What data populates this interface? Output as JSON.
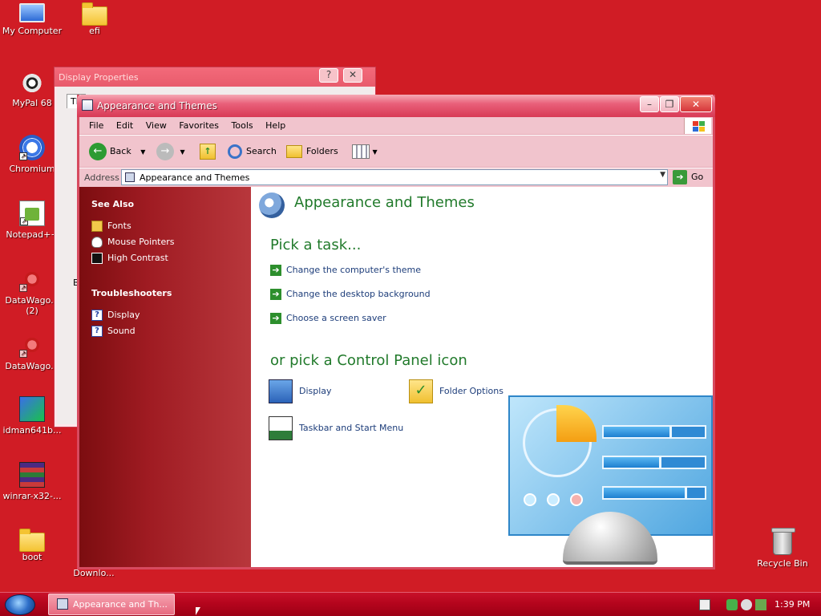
{
  "desktop": {
    "icons": [
      {
        "label": "My Computer",
        "icon": "computer-icon"
      },
      {
        "label": "efi",
        "icon": "folder-icon"
      },
      {
        "label": "MyPal 68",
        "icon": "mypal-icon"
      },
      {
        "label": "Chromium",
        "icon": "chromium-icon"
      },
      {
        "label": "Notepad++",
        "icon": "notepadpp-icon"
      },
      {
        "label": "DataWago...(2)",
        "icon": "datawagon-icon"
      },
      {
        "label": "DataWago...",
        "icon": "datawagon-icon"
      },
      {
        "label": "idman641b...",
        "icon": "idm-icon"
      },
      {
        "label": "winrar-x32-...",
        "icon": "winrar-icon"
      },
      {
        "label": "boot",
        "icon": "folder-icon"
      },
      {
        "label": "Downlo...",
        "icon": "download-icon"
      },
      {
        "label": "Recycle Bin",
        "icon": "recycle-bin-icon"
      }
    ]
  },
  "background_window": {
    "title": "Display Properties",
    "tab_fragment": "Th",
    "side_fragment": "B",
    "help_button": "?",
    "close_button": "✕"
  },
  "window": {
    "title": "Appearance and Themes",
    "menu": [
      "File",
      "Edit",
      "View",
      "Favorites",
      "Tools",
      "Help"
    ],
    "toolbar": {
      "back": "Back",
      "search": "Search",
      "folders": "Folders"
    },
    "address": {
      "label": "Address",
      "value": "Appearance and Themes",
      "go": "Go"
    },
    "sidebar": {
      "see_also_title": "See Also",
      "see_also": [
        "Fonts",
        "Mouse Pointers",
        "High Contrast"
      ],
      "troubleshooters_title": "Troubleshooters",
      "troubleshooters": [
        "Display",
        "Sound"
      ]
    },
    "content": {
      "header": "Appearance and Themes",
      "pick_task": "Pick a task...",
      "tasks": [
        "Change the computer's theme",
        "Change the desktop background",
        "Choose a screen saver"
      ],
      "pick_icon": "or pick a Control Panel icon",
      "icons": [
        "Display",
        "Folder Options",
        "Taskbar and Start Menu"
      ]
    }
  },
  "taskbar": {
    "active_task": "Appearance and Th...",
    "clock": "1:39 PM"
  },
  "colors": {
    "desktop": "#d01c25",
    "sidebar_dark": "#7c0d10",
    "heading_green": "#217a2b",
    "link_blue": "#1d3d7a"
  }
}
